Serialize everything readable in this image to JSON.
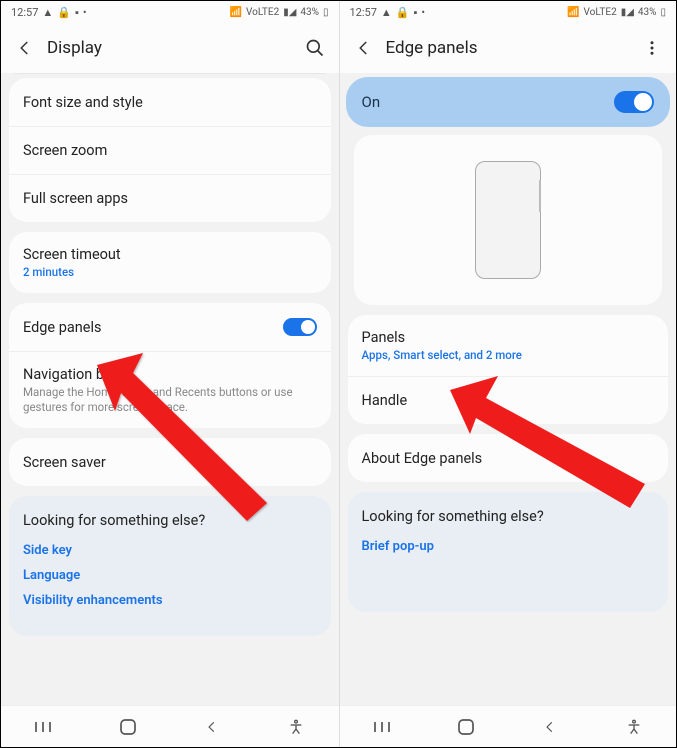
{
  "status": {
    "time": "12:57",
    "battery": "43%",
    "network": "VoLTE2"
  },
  "left": {
    "header_title": "Display",
    "items": {
      "font": "Font size and style",
      "zoom": "Screen zoom",
      "fullscreen": "Full screen apps",
      "timeout": "Screen timeout",
      "timeout_sub": "2 minutes",
      "edge": "Edge panels",
      "nav": "Navigation bar",
      "nav_sub": "Manage the Home, Back, and Recents buttons or use gestures for more screen space.",
      "saver": "Screen saver"
    },
    "looking": {
      "title": "Looking for something else?",
      "links": [
        "Side key",
        "Language",
        "Visibility enhancements"
      ]
    }
  },
  "right": {
    "header_title": "Edge panels",
    "on_label": "On",
    "items": {
      "panels": "Panels",
      "panels_sub": "Apps, Smart select, and 2 more",
      "handle": "Handle",
      "about": "About Edge panels"
    },
    "looking": {
      "title": "Looking for something else?",
      "links": [
        "Brief pop-up"
      ]
    }
  }
}
